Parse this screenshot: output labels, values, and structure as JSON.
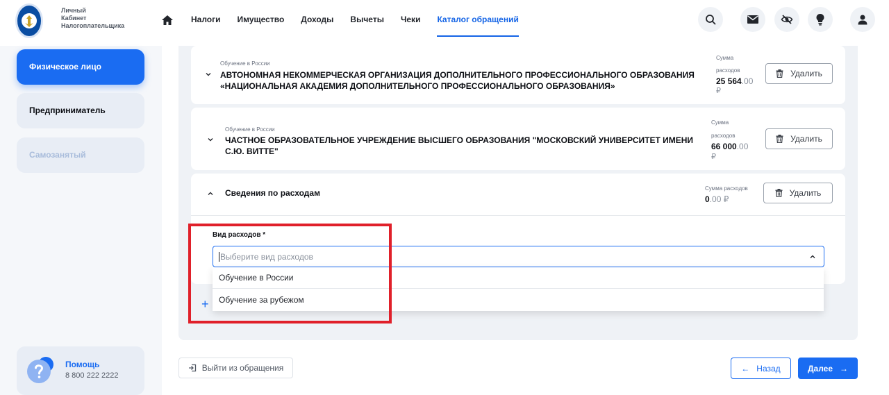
{
  "header": {
    "brand": [
      "Личный",
      "Кабинет",
      "Налогоплательщика"
    ],
    "nav": [
      "Налоги",
      "Имущество",
      "Доходы",
      "Вычеты",
      "Чеки",
      "Каталог обращений"
    ],
    "active_nav": "Каталог обращений",
    "icons": [
      "home-icon",
      "search-icon",
      "mail-icon",
      "eye-off-icon",
      "lightbulb-icon",
      "user-icon"
    ]
  },
  "sidebar": {
    "tabs": [
      {
        "label": "Физическое лицо",
        "state": "active"
      },
      {
        "label": "Предприниматель",
        "state": "normal"
      },
      {
        "label": "Самозанятый",
        "state": "disabled"
      }
    ],
    "help": {
      "title": "Помощь",
      "phone": "8 800 222 2222"
    }
  },
  "cards": [
    {
      "category": "Обучение в России",
      "title": "АВТОНОМНАЯ НЕКОММЕРЧЕСКАЯ ОРГАНИЗАЦИЯ ДОПОЛНИТЕЛЬНОГО ПРОФЕССИОНАЛЬНОГО ОБРАЗОВАНИЯ «НАЦИОНАЛЬНАЯ АКАДЕМИЯ ДОПОЛНИТЕЛЬНОГО ПРОФЕССИОНАЛЬНОГО ОБРАЗОВАНИЯ»",
      "sum_label_1": "Сумма",
      "sum_label_2": "расходов",
      "sum_int": "25 564",
      "sum_dec": ".00",
      "currency": "₽",
      "delete_label": "Удалить"
    },
    {
      "category": "Обучение в России",
      "title": "ЧАСТНОЕ ОБРАЗОВАТЕЛЬНОЕ УЧРЕЖДЕНИЕ ВЫСШЕГО ОБРАЗОВАНИЯ \"МОСКОВСКИЙ УНИВЕРСИТЕТ ИМЕНИ С.Ю. ВИТТЕ\"",
      "sum_label_1": "Сумма",
      "sum_label_2": "расходов",
      "sum_int": "66 000",
      "sum_dec": ".00",
      "currency": "₽",
      "delete_label": "Удалить"
    }
  ],
  "expense_card": {
    "title": "Сведения по расходам",
    "sum_label": "Сумма расходов",
    "sum_int": "0",
    "sum_dec": ".00",
    "currency": "₽",
    "delete_label": "Удалить",
    "field_label": "Вид расходов *",
    "placeholder": "Выберите вид расходов",
    "options": [
      "Обучение в России",
      "Обучение за рубежом"
    ]
  },
  "footer": {
    "exit_label": "Выйти из обращения",
    "back_label": "Назад",
    "next_label": "Далее"
  },
  "colors": {
    "accent": "#1a6cf2",
    "highlight": "#e0202a"
  }
}
